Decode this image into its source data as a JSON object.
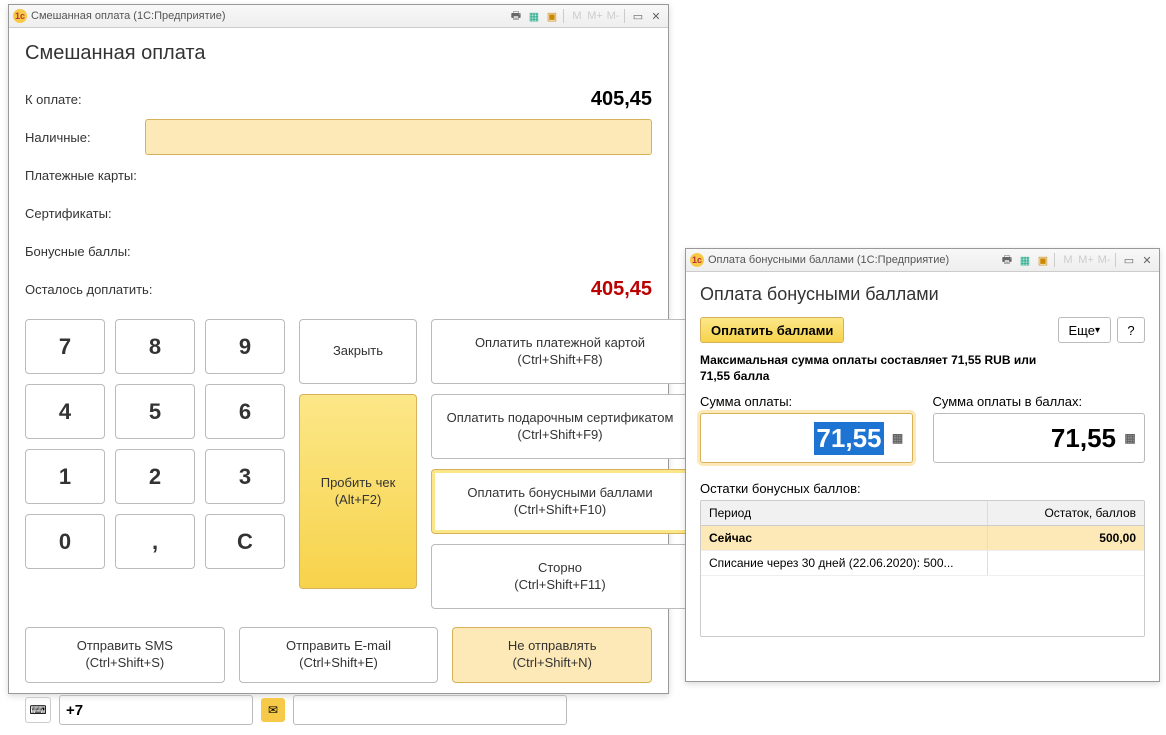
{
  "win1": {
    "logo": "1c",
    "title": "Смешанная оплата  (1С:Предприятие)",
    "heading": "Смешанная оплата",
    "rows": {
      "to_pay_label": "К оплате:",
      "to_pay_value": "405,45",
      "cash_label": "Наличные:",
      "cards_label": "Платежные карты:",
      "certs_label": "Сертификаты:",
      "bonus_label": "Бонусные баллы:",
      "remain_label": "Осталось доплатить:",
      "remain_value": "405,45"
    },
    "numpad": [
      "7",
      "8",
      "9",
      "4",
      "5",
      "6",
      "1",
      "2",
      "3",
      "0",
      ",",
      "C"
    ],
    "close_btn": "Закрыть",
    "punch_btn_line1": "Пробить чек",
    "punch_btn_line2": "(Alt+F2)",
    "pay_card_line1": "Оплатить платежной картой",
    "pay_card_line2": "(Ctrl+Shift+F8)",
    "pay_cert_line1": "Оплатить подарочным сертификатом",
    "pay_cert_line2": "(Ctrl+Shift+F9)",
    "pay_bonus_line1": "Оплатить бонусными баллами",
    "pay_bonus_line2": "(Ctrl+Shift+F10)",
    "storno_line1": "Сторно",
    "storno_line2": "(Ctrl+Shift+F11)",
    "send_sms_line1": "Отправить SMS",
    "send_sms_line2": "(Ctrl+Shift+S)",
    "send_email_line1": "Отправить E-mail",
    "send_email_line2": "(Ctrl+Shift+E)",
    "no_send_line1": "Не отправлять",
    "no_send_line2": "(Ctrl+Shift+N)",
    "phone_prefix": "+7",
    "titlebar_letters": {
      "m1": "M",
      "m2": "M+",
      "m3": "M-"
    }
  },
  "win2": {
    "logo": "1c",
    "title": "Оплата бонусными баллами  (1С:Предприятие)",
    "heading": "Оплата бонусными баллами",
    "pay_btn": "Оплатить баллами",
    "more_btn": "Еще",
    "question": "?",
    "max_note_1": "Максимальная сумма оплаты составляет 71,55 RUB или",
    "max_note_2": "71,55 балла",
    "sum_label": "Сумма оплаты:",
    "sum_value": "71,55",
    "sum_points_label": "Сумма оплаты в баллах:",
    "sum_points_value": "71,55",
    "balances_label": "Остатки бонусных баллов:",
    "table": {
      "col1": "Период",
      "col2": "Остаток, баллов",
      "rows": [
        {
          "c1": "Сейчас",
          "c2": "500,00",
          "hl": true
        },
        {
          "c1": "Списание через 30 дней (22.06.2020): 500...",
          "c2": "",
          "hl": false
        }
      ]
    },
    "titlebar_letters": {
      "m1": "M",
      "m2": "M+",
      "m3": "M-"
    }
  }
}
